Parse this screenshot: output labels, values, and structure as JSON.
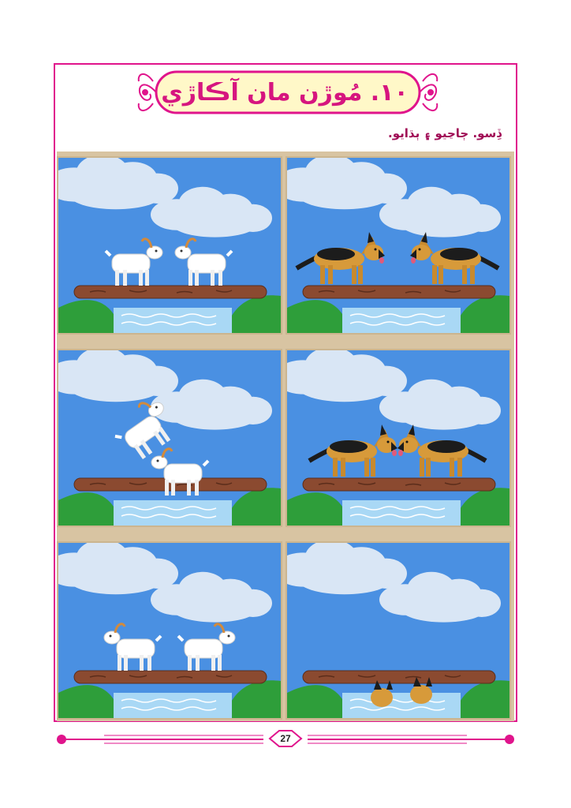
{
  "lesson": {
    "title": "۱۰. مُوڙن مان آڪاڙي",
    "instruction": "ڏِسو. ڄاڃيو ۽ ٻڌايو."
  },
  "panels": [
    {
      "id": "goats-meet",
      "subject": "goats"
    },
    {
      "id": "dogs-meet",
      "subject": "dogs"
    },
    {
      "id": "goats-pass",
      "subject": "goats"
    },
    {
      "id": "dogs-fight",
      "subject": "dogs"
    },
    {
      "id": "goats-done",
      "subject": "goats"
    },
    {
      "id": "dogs-fall",
      "subject": "dogs"
    }
  ],
  "footer": {
    "page_number": "27"
  },
  "colors": {
    "accent": "#e0148c",
    "title": "#d6157f",
    "banner_fill": "#fff8c8",
    "sky": "#4a90e2",
    "grass": "#2e9e3a",
    "water": "#a9d8f5",
    "log": "#8b4a30"
  }
}
